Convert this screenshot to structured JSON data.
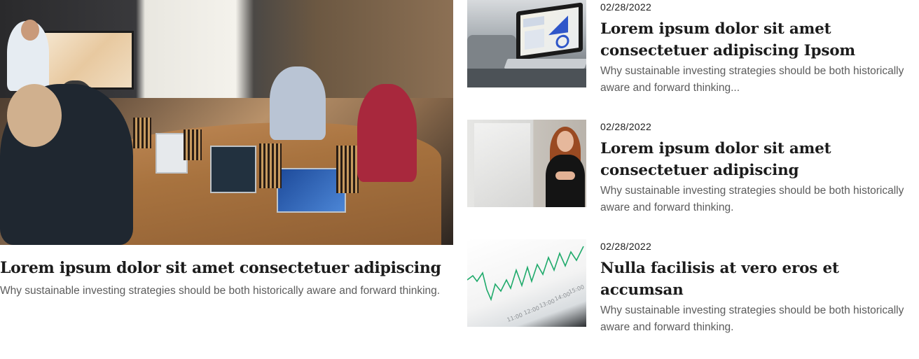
{
  "featured": {
    "title": "Lorem ipsum dolor sit amet consectetuer adipiscing",
    "description": "Why sustainable investing strategies should be both historically aware and forward thinking.",
    "image_alt": "team-meeting-photo"
  },
  "cards": [
    {
      "date": "02/28/2022",
      "title": "Lorem ipsum dolor sit amet consectetuer adipiscing Ipsom",
      "description": "Why sustainable investing strategies should be both historically aware and forward thinking...",
      "image": "laptop-analytics-photo"
    },
    {
      "date": "02/28/2022",
      "title": "Lorem ipsum dolor sit amet consectetuer adipiscing",
      "description": "Why sustainable investing strategies should be both historically aware and forward thinking.",
      "image": "woman-presenting-photo"
    },
    {
      "date": "02/28/2022",
      "title": "Nulla facilisis at vero eros et accumsan",
      "description": "Why sustainable investing strategies should be both historically aware and forward thinking.",
      "image": "stock-chart-photo",
      "chart_tick_labels": [
        "11:00",
        "12:00",
        "13:00",
        "14:00",
        "15:00"
      ]
    }
  ],
  "colors": {
    "title": "#1c1c1c",
    "body_text": "#5c5c5c",
    "chart_line": "#1faa6b"
  }
}
